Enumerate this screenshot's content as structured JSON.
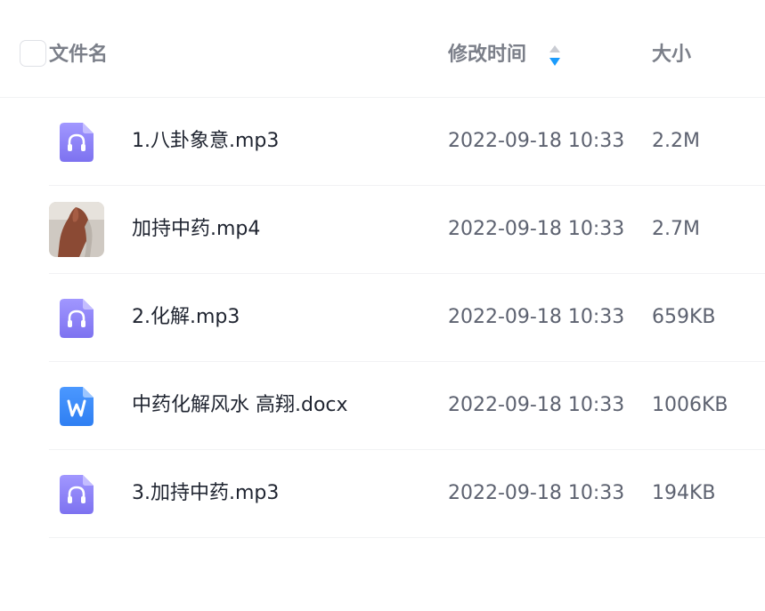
{
  "header": {
    "name_label": "文件名",
    "time_label": "修改时间",
    "size_label": "大小",
    "sort_active_color": "#1a9bfc",
    "sort_inactive_color": "#c9ccd3"
  },
  "files": [
    {
      "name": "1.八卦象意.mp3",
      "modified": "2022-09-18 10:33",
      "size": "2.2M",
      "icon": "audio-file-icon"
    },
    {
      "name": "加持中药.mp4",
      "modified": "2022-09-18 10:33",
      "size": "2.7M",
      "icon": "video-thumbnail"
    },
    {
      "name": "2.化解.mp3",
      "modified": "2022-09-18 10:33",
      "size": "659KB",
      "icon": "audio-file-icon"
    },
    {
      "name": "中药化解风水 高翔.docx",
      "modified": "2022-09-18 10:33",
      "size": "1006KB",
      "icon": "word-file-icon"
    },
    {
      "name": "3.加持中药.mp3",
      "modified": "2022-09-18 10:33",
      "size": "194KB",
      "icon": "audio-file-icon"
    }
  ],
  "colors": {
    "audio_icon": "#8b7ff7",
    "word_icon": "#3b86f7"
  }
}
